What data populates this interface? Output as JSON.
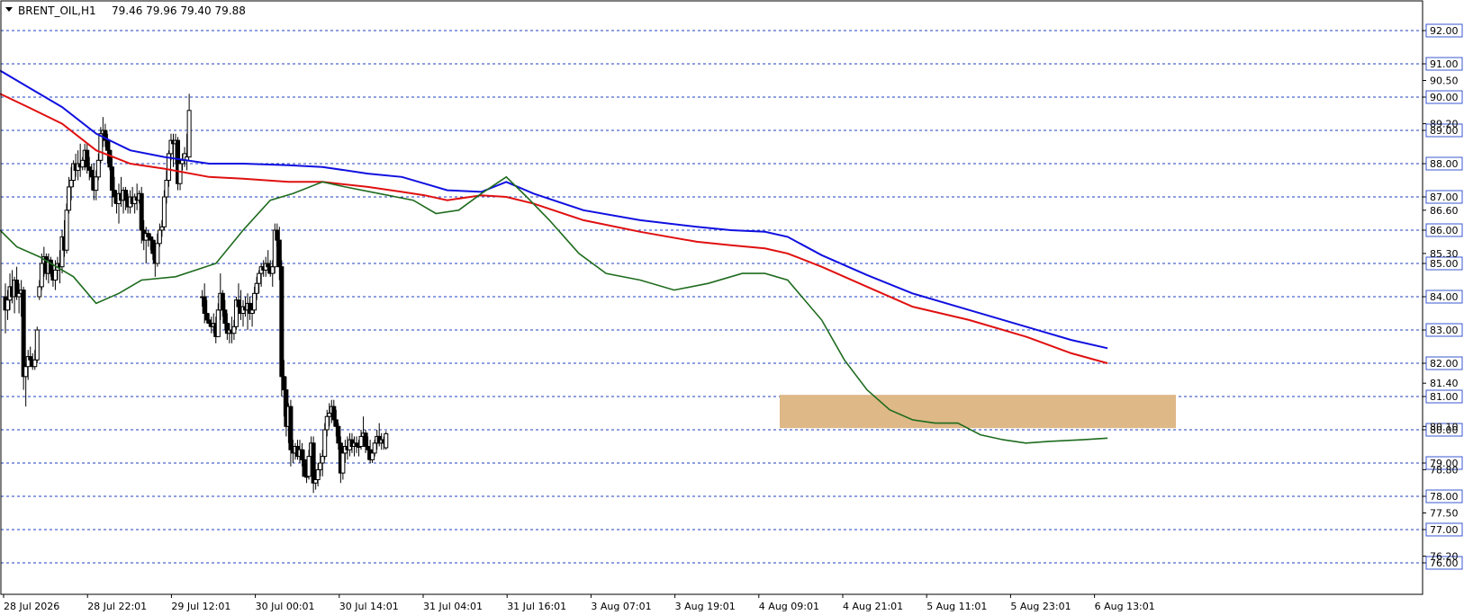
{
  "header": {
    "symbol_timeframe": "BRENT_OIL,H1",
    "ohlc": "79.46 79.96 79.40 79.88"
  },
  "colors": {
    "grid": "#1f3fbf",
    "ma_blue": "#1010e0",
    "ma_red": "#e01010",
    "ma_green": "#1e6b1e",
    "zone": "#deb887",
    "candle": "#000000",
    "label_box": "#3a57d0"
  },
  "chart_data": {
    "type": "candlestick",
    "y_axis": {
      "range": [
        75.8,
        92.6
      ],
      "boxed_levels": [
        92.0,
        91.0,
        90.0,
        89.0,
        88.0,
        87.0,
        86.0,
        85.0,
        84.0,
        83.0,
        82.0,
        81.0,
        80.0,
        79.0,
        78.0,
        77.0,
        76.0
      ],
      "boxed_labels": [
        "92.00",
        "91.00",
        "90.00",
        "89.00",
        "88.00",
        "87.00",
        "86.00",
        "85.00",
        "84.00",
        "83.00",
        "82.00",
        "81.00",
        "80.00",
        "79.00",
        "78.00",
        "77.00",
        "76.00"
      ],
      "extra_ticks": [
        90.5,
        89.2,
        86.6,
        85.3,
        81.4,
        80.1,
        78.8,
        77.5,
        76.2
      ],
      "extra_labels": [
        "90.50",
        "89.20",
        "86.60",
        "85.30",
        "81.40",
        "80.10",
        "78.80",
        "77.50",
        "76.20"
      ]
    },
    "x_axis": {
      "labels": [
        "28 Jul 2026",
        "28 Jul 22:01",
        "29 Jul 12:01",
        "30 Jul 00:01",
        "30 Jul 14:01",
        "31 Jul 04:01",
        "31 Jul 16:01",
        "3 Aug 07:01",
        "3 Aug 19:01",
        "4 Aug 09:01",
        "4 Aug 21:01",
        "5 Aug 11:01",
        "5 Aug 23:01",
        "6 Aug 13:01"
      ]
    },
    "zone": {
      "low": 80.05,
      "high": 81.05
    },
    "candles": [
      [
        84.0,
        84.4,
        82.9,
        83.6
      ],
      [
        83.6,
        84.2,
        83.3,
        83.9
      ],
      [
        83.9,
        84.7,
        83.6,
        84.3
      ],
      [
        84.3,
        84.8,
        83.8,
        84.0
      ],
      [
        84.0,
        84.6,
        83.5,
        84.5
      ],
      [
        84.5,
        84.9,
        83.9,
        84.0
      ],
      [
        84.0,
        84.4,
        83.5,
        84.1
      ],
      [
        84.1,
        84.5,
        83.4,
        84.2
      ],
      [
        84.2,
        84.3,
        81.2,
        81.6
      ],
      [
        81.6,
        82.0,
        80.7,
        81.9
      ],
      [
        81.9,
        82.4,
        81.5,
        82.2
      ],
      [
        82.2,
        82.5,
        81.9,
        82.1
      ],
      [
        82.1,
        82.3,
        81.8,
        81.9
      ],
      [
        81.9,
        82.4,
        81.8,
        82.1
      ],
      [
        82.1,
        83.1,
        82.0,
        83.0
      ],
      [
        84.0,
        84.5,
        83.9,
        84.3
      ],
      [
        84.3,
        85.3,
        84.2,
        85.0
      ],
      [
        85.0,
        85.5,
        84.6,
        85.2
      ],
      [
        85.2,
        85.3,
        84.5,
        84.7
      ],
      [
        84.7,
        85.3,
        84.4,
        85.1
      ],
      [
        85.1,
        85.2,
        84.6,
        84.7
      ],
      [
        84.7,
        85.0,
        84.3,
        84.5
      ],
      [
        84.5,
        85.1,
        84.2,
        84.8
      ],
      [
        84.8,
        85.2,
        84.5,
        85.0
      ],
      [
        85.0,
        85.4,
        84.4,
        84.9
      ],
      [
        84.9,
        86.0,
        84.7,
        85.8
      ],
      [
        85.8,
        86.3,
        85.2,
        85.4
      ],
      [
        85.4,
        86.8,
        85.3,
        86.6
      ],
      [
        86.6,
        87.6,
        86.5,
        87.3
      ],
      [
        87.3,
        87.9,
        86.9,
        87.5
      ],
      [
        87.5,
        88.1,
        87.3,
        88.0
      ],
      [
        88.0,
        88.3,
        87.6,
        87.8
      ],
      [
        87.8,
        88.4,
        87.5,
        88.0
      ],
      [
        88.0,
        88.6,
        87.6,
        87.9
      ],
      [
        87.9,
        88.2,
        87.8,
        88.1
      ],
      [
        88.1,
        88.6,
        87.8,
        88.4
      ],
      [
        88.4,
        88.6,
        87.7,
        87.9
      ],
      [
        87.9,
        88.2,
        87.5,
        87.8
      ],
      [
        87.8,
        88.0,
        87.2,
        87.6
      ],
      [
        87.6,
        88.0,
        86.9,
        87.2
      ],
      [
        87.2,
        87.8,
        86.9,
        87.6
      ],
      [
        87.6,
        88.3,
        87.5,
        88.1
      ],
      [
        88.1,
        89.1,
        88.0,
        88.9
      ],
      [
        88.9,
        89.4,
        88.5,
        89.0
      ],
      [
        89.0,
        89.2,
        88.5,
        88.7
      ],
      [
        88.7,
        88.9,
        88.0,
        88.4
      ],
      [
        88.4,
        88.7,
        87.8,
        87.9
      ],
      [
        87.9,
        88.2,
        86.7,
        87.2
      ],
      [
        87.2,
        87.6,
        86.8,
        87.0
      ],
      [
        87.0,
        87.2,
        86.5,
        86.8
      ],
      [
        86.8,
        87.4,
        86.2,
        87.1
      ],
      [
        87.1,
        87.6,
        86.7,
        86.9
      ],
      [
        86.9,
        87.3,
        86.5,
        87.2
      ],
      [
        87.2,
        87.3,
        86.6,
        86.9
      ],
      [
        86.9,
        87.1,
        86.5,
        86.7
      ],
      [
        86.7,
        87.2,
        86.5,
        87.0
      ],
      [
        87.0,
        87.3,
        86.7,
        86.8
      ],
      [
        86.8,
        87.1,
        86.5,
        87.0
      ],
      [
        87.0,
        87.4,
        86.6,
        86.9
      ],
      [
        86.9,
        87.2,
        86.8,
        87.1
      ],
      [
        87.1,
        87.3,
        85.6,
        86.0
      ],
      [
        86.0,
        86.3,
        85.4,
        85.7
      ],
      [
        85.7,
        86.1,
        85.0,
        85.9
      ],
      [
        85.9,
        86.0,
        85.5,
        85.8
      ],
      [
        85.8,
        85.9,
        85.4,
        85.7
      ],
      [
        85.7,
        85.8,
        85.1,
        85.3
      ],
      [
        85.3,
        85.7,
        84.6,
        85.0
      ],
      [
        85.0,
        85.9,
        84.9,
        85.6
      ],
      [
        85.6,
        86.2,
        85.5,
        86.0
      ],
      [
        86.0,
        86.3,
        85.8,
        86.1
      ],
      [
        86.1,
        87.2,
        86.0,
        87.0
      ],
      [
        87.0,
        87.8,
        86.8,
        87.5
      ],
      [
        87.5,
        88.4,
        87.3,
        88.3
      ],
      [
        88.3,
        88.9,
        88.1,
        88.7
      ],
      [
        88.7,
        88.9,
        87.9,
        88.6
      ],
      [
        88.6,
        88.9,
        88.0,
        88.7
      ],
      [
        88.7,
        88.8,
        87.2,
        87.4
      ],
      [
        87.4,
        88.1,
        87.2,
        88.0
      ],
      [
        88.0,
        88.3,
        87.8,
        88.1
      ],
      [
        88.1,
        88.5,
        87.9,
        88.3
      ],
      [
        88.1,
        88.9,
        87.8,
        88.2
      ],
      [
        88.2,
        90.1,
        88.2,
        89.6
      ],
      [
        84.0,
        84.2,
        83.7,
        84.0
      ],
      [
        84.0,
        84.4,
        83.2,
        83.5
      ],
      [
        83.5,
        83.9,
        83.2,
        83.3
      ],
      [
        83.3,
        83.5,
        83.1,
        83.2
      ],
      [
        83.2,
        83.4,
        82.9,
        83.1
      ],
      [
        83.1,
        83.5,
        82.9,
        83.2
      ],
      [
        83.2,
        83.4,
        82.6,
        82.8
      ],
      [
        82.8,
        83.8,
        82.8,
        83.6
      ],
      [
        83.6,
        84.7,
        83.3,
        84.1
      ],
      [
        84.1,
        84.2,
        83.4,
        83.6
      ],
      [
        83.6,
        83.9,
        83.0,
        83.2
      ],
      [
        83.2,
        83.5,
        82.7,
        82.9
      ],
      [
        82.9,
        83.2,
        82.6,
        83.0
      ],
      [
        83.0,
        83.4,
        82.6,
        82.9
      ],
      [
        82.9,
        83.3,
        82.7,
        83.1
      ],
      [
        83.1,
        84.0,
        83.0,
        83.9
      ],
      [
        83.9,
        84.4,
        83.5,
        83.7
      ],
      [
        83.7,
        84.2,
        83.3,
        83.5
      ],
      [
        83.5,
        83.9,
        83.1,
        83.7
      ],
      [
        83.7,
        84.0,
        83.4,
        83.6
      ],
      [
        83.6,
        84.1,
        83.0,
        83.8
      ],
      [
        83.8,
        84.0,
        83.3,
        83.5
      ],
      [
        83.5,
        83.8,
        83.1,
        83.6
      ],
      [
        83.6,
        84.3,
        83.5,
        84.1
      ],
      [
        84.1,
        84.6,
        83.9,
        84.4
      ],
      [
        84.4,
        84.8,
        84.1,
        84.7
      ],
      [
        84.7,
        85.0,
        84.3,
        84.9
      ],
      [
        84.9,
        85.1,
        84.6,
        84.8
      ],
      [
        84.8,
        85.2,
        84.6,
        85.0
      ],
      [
        85.0,
        85.4,
        84.7,
        84.9
      ],
      [
        84.9,
        85.1,
        84.6,
        84.7
      ],
      [
        84.7,
        85.1,
        84.3,
        84.9
      ],
      [
        84.9,
        86.2,
        84.7,
        86.0
      ],
      [
        86.0,
        86.2,
        85.5,
        85.7
      ],
      [
        85.7,
        86.1,
        84.5,
        84.9
      ],
      [
        84.9,
        85.1,
        81.0,
        81.6
      ],
      [
        81.6,
        82.1,
        80.4,
        81.2
      ],
      [
        81.2,
        81.6,
        79.8,
        80.1
      ],
      [
        80.1,
        80.8,
        79.6,
        80.7
      ],
      [
        80.7,
        80.9,
        78.9,
        79.4
      ],
      [
        79.4,
        79.7,
        79.0,
        79.3
      ],
      [
        79.3,
        79.6,
        79.1,
        79.5
      ],
      [
        79.5,
        79.7,
        79.1,
        79.2
      ],
      [
        79.2,
        79.7,
        79.0,
        79.4
      ],
      [
        79.4,
        79.6,
        78.9,
        79.1
      ],
      [
        79.1,
        79.4,
        78.7,
        78.6
      ],
      [
        78.6,
        79.0,
        78.4,
        78.6
      ],
      [
        78.6,
        79.4,
        78.5,
        79.2
      ],
      [
        79.2,
        79.8,
        79.0,
        79.6
      ],
      [
        79.6,
        79.8,
        78.1,
        78.4
      ],
      [
        78.4,
        78.8,
        78.2,
        78.5
      ],
      [
        78.5,
        79.0,
        78.3,
        78.8
      ],
      [
        78.8,
        79.3,
        78.6,
        79.0
      ],
      [
        79.0,
        79.4,
        78.6,
        79.2
      ],
      [
        79.2,
        80.2,
        79.1,
        80.0
      ],
      [
        80.0,
        80.6,
        79.8,
        80.4
      ],
      [
        80.4,
        80.8,
        80.1,
        80.5
      ],
      [
        80.5,
        80.9,
        80.2,
        80.7
      ],
      [
        80.7,
        80.9,
        80.1,
        80.3
      ],
      [
        80.3,
        80.6,
        79.8,
        80.1
      ],
      [
        80.1,
        80.2,
        79.4,
        79.6
      ],
      [
        79.6,
        79.8,
        78.4,
        78.7
      ],
      [
        78.7,
        79.5,
        78.5,
        79.3
      ],
      [
        79.3,
        79.7,
        79.0,
        79.5
      ],
      [
        79.5,
        79.8,
        79.1,
        79.4
      ],
      [
        79.4,
        79.9,
        79.2,
        79.7
      ],
      [
        79.7,
        79.9,
        79.3,
        79.5
      ],
      [
        79.5,
        79.8,
        79.2,
        79.6
      ],
      [
        79.6,
        79.8,
        79.3,
        79.5
      ],
      [
        79.5,
        79.7,
        79.2,
        79.5
      ],
      [
        79.5,
        80.0,
        79.4,
        79.8
      ],
      [
        79.8,
        80.4,
        79.6,
        79.9
      ],
      [
        79.9,
        80.0,
        79.3,
        79.5
      ],
      [
        79.5,
        79.8,
        79.1,
        79.4
      ],
      [
        79.4,
        79.7,
        79.0,
        79.1
      ],
      [
        79.1,
        79.4,
        79.0,
        79.3
      ],
      [
        79.3,
        79.7,
        79.2,
        79.6
      ],
      [
        79.6,
        80.0,
        79.4,
        79.8
      ],
      [
        79.8,
        80.2,
        79.5,
        79.6
      ],
      [
        79.6,
        79.9,
        79.4,
        79.7
      ],
      [
        79.7,
        79.8,
        79.4,
        79.6
      ],
      [
        79.46,
        79.96,
        79.4,
        79.88
      ]
    ],
    "ma_blue": [
      [
        0,
        90.8
      ],
      [
        10,
        90.3
      ],
      [
        25,
        89.7
      ],
      [
        40,
        88.9
      ],
      [
        55,
        88.4
      ],
      [
        70,
        88.2
      ],
      [
        85,
        88.0
      ],
      [
        100,
        88.0
      ],
      [
        120,
        87.95
      ],
      [
        135,
        87.9
      ],
      [
        155,
        87.7
      ],
      [
        170,
        87.6
      ],
      [
        180,
        87.4
      ],
      [
        190,
        87.2
      ],
      [
        205,
        87.15
      ],
      [
        216,
        87.45
      ],
      [
        228,
        87.1
      ],
      [
        250,
        86.6
      ],
      [
        275,
        86.3
      ],
      [
        300,
        86.1
      ],
      [
        315,
        86.0
      ],
      [
        330,
        85.95
      ],
      [
        340,
        85.8
      ],
      [
        355,
        85.25
      ],
      [
        375,
        84.65
      ],
      [
        395,
        84.1
      ],
      [
        420,
        83.6
      ],
      [
        445,
        83.1
      ],
      [
        465,
        82.7
      ],
      [
        481,
        82.45
      ]
    ],
    "ma_red": [
      [
        0,
        90.1
      ],
      [
        10,
        89.7
      ],
      [
        25,
        89.2
      ],
      [
        40,
        88.4
      ],
      [
        55,
        88.0
      ],
      [
        70,
        87.85
      ],
      [
        85,
        87.6
      ],
      [
        100,
        87.55
      ],
      [
        120,
        87.45
      ],
      [
        135,
        87.45
      ],
      [
        155,
        87.3
      ],
      [
        170,
        87.15
      ],
      [
        180,
        87.05
      ],
      [
        190,
        86.9
      ],
      [
        205,
        87.05
      ],
      [
        216,
        87.0
      ],
      [
        228,
        86.8
      ],
      [
        250,
        86.3
      ],
      [
        275,
        85.95
      ],
      [
        300,
        85.65
      ],
      [
        315,
        85.55
      ],
      [
        330,
        85.45
      ],
      [
        340,
        85.3
      ],
      [
        355,
        84.9
      ],
      [
        375,
        84.3
      ],
      [
        395,
        83.7
      ],
      [
        420,
        83.3
      ],
      [
        445,
        82.8
      ],
      [
        465,
        82.3
      ],
      [
        481,
        82.0
      ]
    ],
    "ma_green": [
      [
        0,
        86.0
      ],
      [
        5,
        85.5
      ],
      [
        15,
        85.2
      ],
      [
        30,
        84.6
      ],
      [
        40,
        83.8
      ],
      [
        50,
        84.1
      ],
      [
        60,
        84.5
      ],
      [
        75,
        84.6
      ],
      [
        88,
        85.0
      ],
      [
        100,
        86.0
      ],
      [
        112,
        86.9
      ],
      [
        122,
        87.1
      ],
      [
        135,
        87.45
      ],
      [
        145,
        87.3
      ],
      [
        160,
        87.1
      ],
      [
        175,
        86.9
      ],
      [
        185,
        86.5
      ],
      [
        195,
        86.6
      ],
      [
        205,
        87.1
      ],
      [
        216,
        87.6
      ],
      [
        225,
        87.0
      ],
      [
        235,
        86.3
      ],
      [
        248,
        85.3
      ],
      [
        260,
        84.7
      ],
      [
        275,
        84.5
      ],
      [
        290,
        84.2
      ],
      [
        305,
        84.4
      ],
      [
        320,
        84.7
      ],
      [
        330,
        84.7
      ],
      [
        340,
        84.5
      ],
      [
        355,
        83.3
      ],
      [
        365,
        82.1
      ],
      [
        375,
        81.2
      ],
      [
        385,
        80.6
      ],
      [
        395,
        80.3
      ],
      [
        405,
        80.2
      ],
      [
        415,
        80.2
      ],
      [
        425,
        79.85
      ],
      [
        435,
        79.7
      ],
      [
        445,
        79.6
      ],
      [
        455,
        79.65
      ],
      [
        470,
        79.7
      ],
      [
        481,
        79.75
      ]
    ]
  }
}
